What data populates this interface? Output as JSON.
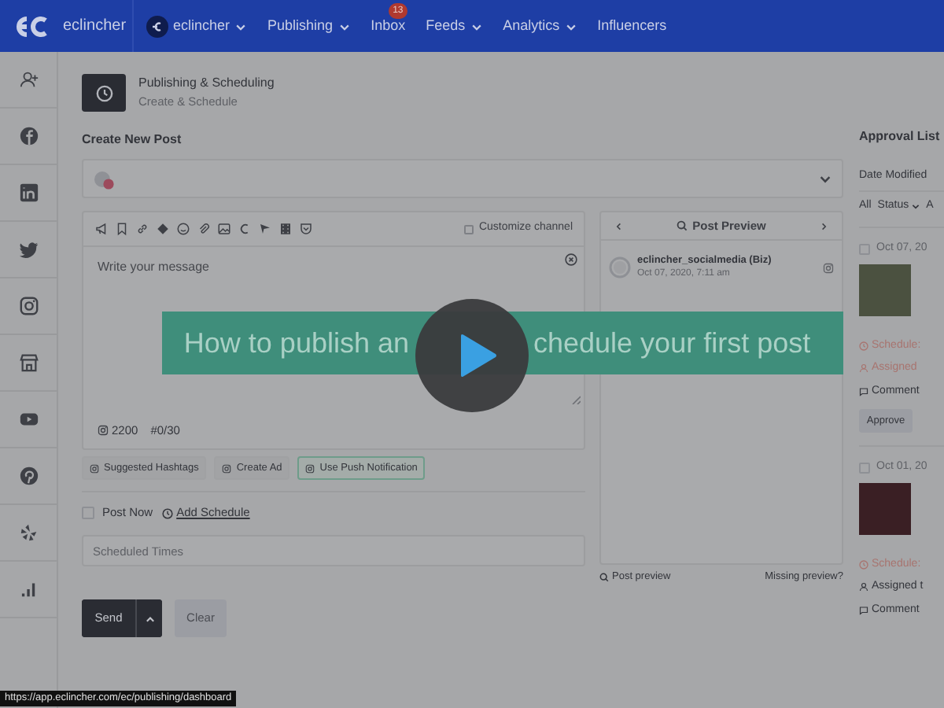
{
  "top_bar": {
    "brand": "eclincher",
    "nav": [
      {
        "label": "eclincher",
        "kind": "account",
        "dropdown": true
      },
      {
        "label": "Publishing",
        "kind": "link",
        "dropdown": true
      },
      {
        "label": "Inbox",
        "kind": "link",
        "dropdown": false,
        "badge": "13"
      },
      {
        "label": "Feeds",
        "kind": "link",
        "dropdown": true
      },
      {
        "label": "Analytics",
        "kind": "link",
        "dropdown": true
      },
      {
        "label": "Influencers",
        "kind": "link",
        "dropdown": false
      }
    ]
  },
  "page_header": {
    "title": "Publishing & Scheduling",
    "subtitle": "Create & Schedule"
  },
  "composer": {
    "heading": "Create New Post",
    "customize_channel": {
      "label": "Customize channel",
      "checked": false
    },
    "placeholder": "Write your message",
    "char_limit": "2200",
    "hashtag_count": "#0/30",
    "options": [
      {
        "label": "Suggested Hashtags",
        "selected": false
      },
      {
        "label": "Create Ad",
        "selected": false
      },
      {
        "label": "Use Push Notification",
        "selected": true
      }
    ],
    "post_now": {
      "label": "Post Now",
      "checked": false
    },
    "add_schedule": "Add Schedule",
    "scheduled_times": {
      "placeholder": "Scheduled Times"
    },
    "send": "Send",
    "clear": "Clear"
  },
  "preview": {
    "title": "Post Preview",
    "account": "eclincher_socialmedia (Biz)",
    "timestamp": "Oct 07, 2020, 7:11 am",
    "link": "Post preview",
    "missing": "Missing preview?"
  },
  "approval_list": {
    "title": "Approval List",
    "sort": "Date Modified",
    "filters": [
      {
        "label": "All",
        "dropdown": false
      },
      {
        "label": "Status",
        "dropdown": true
      },
      {
        "label": "A",
        "dropdown": false
      }
    ],
    "items": [
      {
        "date": "Oct 07, 20",
        "checked": false,
        "schedule": "Schedule:",
        "schedule_alert": true,
        "assigned": "Assigned",
        "assigned_alert": true,
        "comment": "Comment",
        "approve": "Approve"
      },
      {
        "date": "Oct 01, 20",
        "checked": false,
        "schedule": "Schedule:",
        "schedule_alert": true,
        "assigned": "Assigned t",
        "assigned_alert": false,
        "comment": "Comment"
      }
    ]
  },
  "video": {
    "title_parts": [
      "How to publish an",
      "chedule your first post"
    ]
  },
  "status_url": "https://app.eclincher.com/ec/publishing/dashboard"
}
